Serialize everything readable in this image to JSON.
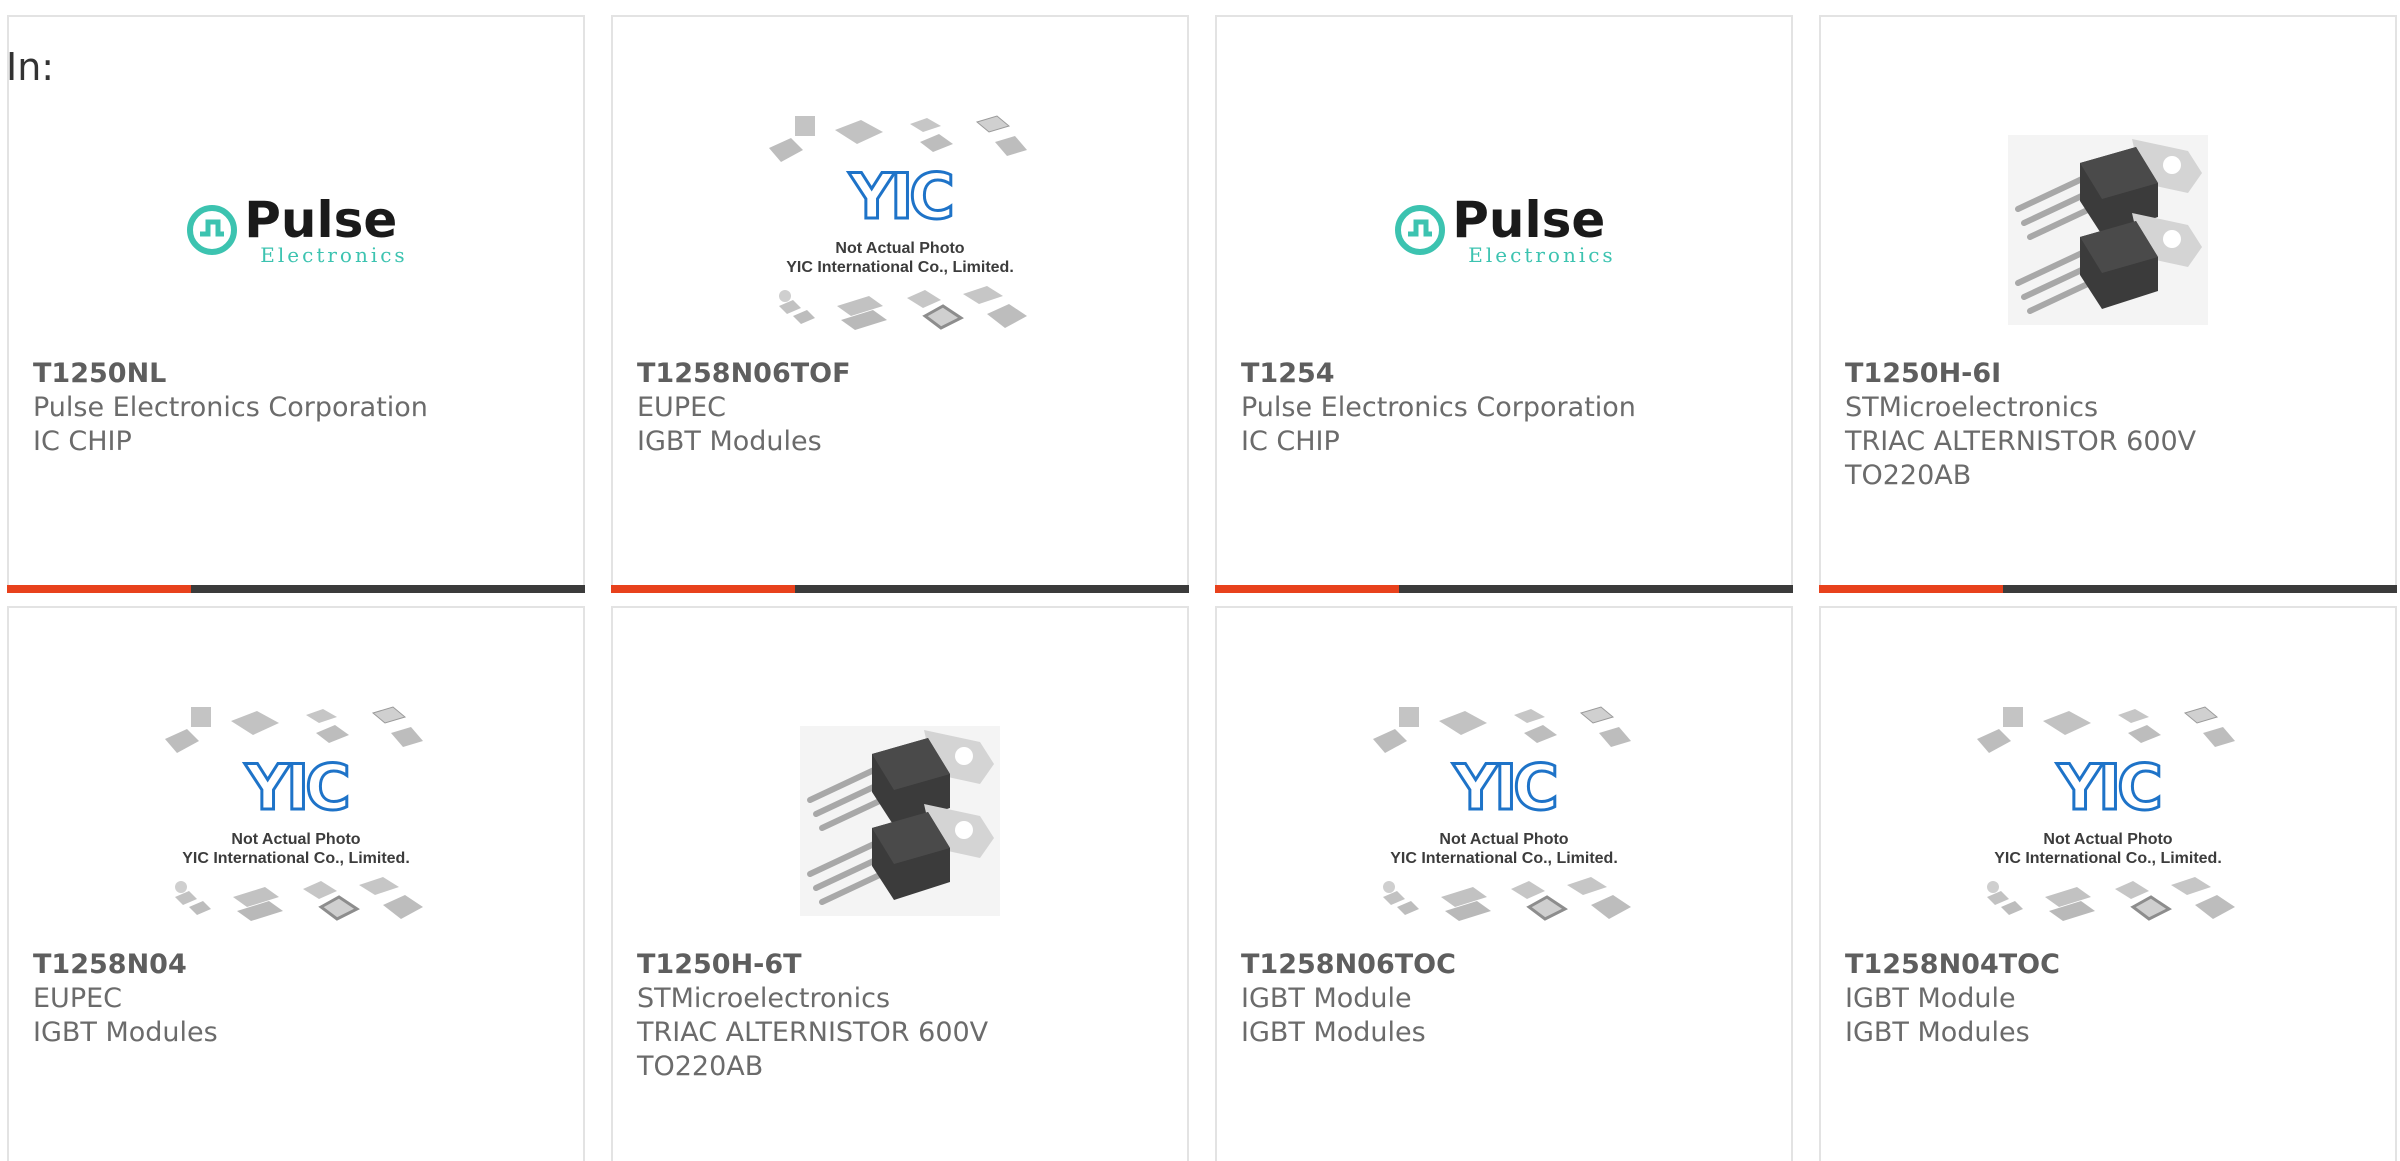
{
  "filter": {
    "label": "In:"
  },
  "brand": {
    "accent": "#e8411c",
    "bar": "#3b3b3b",
    "pulse": "#3cc3b0",
    "yic": "#1e73c8"
  },
  "cards": [
    {
      "part": "T1250NL",
      "maker": "Pulse Electronics Corporation",
      "desc": [
        "IC CHIP"
      ],
      "image": "pulse-logo"
    },
    {
      "part": "T1258N06TOF",
      "maker": "EUPEC",
      "desc": [
        "IGBT Modules"
      ],
      "image": "yic-placeholder"
    },
    {
      "part": "T1254",
      "maker": "Pulse Electronics Corporation",
      "desc": [
        "IC CHIP"
      ],
      "image": "pulse-logo"
    },
    {
      "part": "T1250H-6I",
      "maker": "STMicroelectronics",
      "desc": [
        "TRIAC ALTERNISTOR 600V",
        "TO220AB"
      ],
      "image": "to220-photo"
    },
    {
      "part": "T1258N04",
      "maker": "EUPEC",
      "desc": [
        "IGBT Modules"
      ],
      "image": "yic-placeholder"
    },
    {
      "part": "T1250H-6T",
      "maker": "STMicroelectronics",
      "desc": [
        "TRIAC ALTERNISTOR 600V",
        "TO220AB"
      ],
      "image": "to220-photo"
    },
    {
      "part": "T1258N06TOC",
      "maker": "IGBT Module",
      "desc": [
        "IGBT Modules"
      ],
      "image": "yic-placeholder"
    },
    {
      "part": "T1258N04TOC",
      "maker": "IGBT Module",
      "desc": [
        "IGBT Modules"
      ],
      "image": "yic-placeholder"
    }
  ],
  "pulse_logo": {
    "word": "Pulse",
    "sub": "Electronics"
  },
  "yic_placeholder": {
    "mark": "YIC",
    "line1": "Not Actual Photo",
    "line2": "YIC International Co., Limited."
  }
}
